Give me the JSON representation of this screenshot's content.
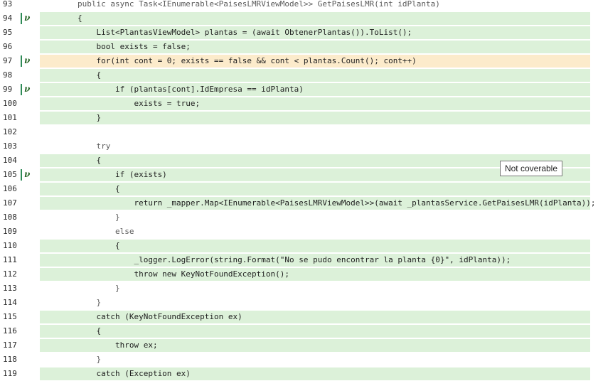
{
  "tooltip": "Not coverable",
  "lines": [
    {
      "n": "93",
      "code": "        public async Task<IEnumerable<PaisesLMRViewModel>> GetPaisesLMR(int idPlanta)",
      "cov": "none",
      "branch": false
    },
    {
      "n": "94",
      "code": "        {",
      "cov": "covered",
      "branch": true
    },
    {
      "n": "95",
      "code": "            List<PlantasViewModel> plantas = (await ObtenerPlantas()).ToList();",
      "cov": "covered",
      "branch": false
    },
    {
      "n": "96",
      "code": "            bool exists = false;",
      "cov": "covered",
      "branch": false
    },
    {
      "n": "97",
      "code": "            for(int cont = 0; exists == false && cont < plantas.Count(); cont++)",
      "cov": "partial",
      "branch": true
    },
    {
      "n": "98",
      "code": "            {",
      "cov": "covered",
      "branch": false
    },
    {
      "n": "99",
      "code": "                if (plantas[cont].IdEmpresa == idPlanta)",
      "cov": "covered",
      "branch": true
    },
    {
      "n": "100",
      "code": "                    exists = true;",
      "cov": "covered",
      "branch": false
    },
    {
      "n": "101",
      "code": "            }",
      "cov": "covered",
      "branch": false
    },
    {
      "n": "102",
      "code": "",
      "cov": "none",
      "branch": false
    },
    {
      "n": "103",
      "code": "            try",
      "cov": "none",
      "branch": false
    },
    {
      "n": "104",
      "code": "            {",
      "cov": "covered",
      "branch": false
    },
    {
      "n": "105",
      "code": "                if (exists)",
      "cov": "covered",
      "branch": true
    },
    {
      "n": "106",
      "code": "                {",
      "cov": "covered",
      "branch": false
    },
    {
      "n": "107",
      "code": "                    return _mapper.Map<IEnumerable<PaisesLMRViewModel>>(await _plantasService.GetPaisesLMR(idPlanta));",
      "cov": "covered",
      "branch": false
    },
    {
      "n": "108",
      "code": "                }",
      "cov": "none",
      "branch": false
    },
    {
      "n": "109",
      "code": "                else",
      "cov": "none",
      "branch": false
    },
    {
      "n": "110",
      "code": "                {",
      "cov": "covered",
      "branch": false
    },
    {
      "n": "111",
      "code": "                    _logger.LogError(string.Format(\"No se pudo encontrar la planta {0}\", idPlanta));",
      "cov": "covered",
      "branch": false
    },
    {
      "n": "112",
      "code": "                    throw new KeyNotFoundException();",
      "cov": "covered",
      "branch": false
    },
    {
      "n": "113",
      "code": "                }",
      "cov": "none",
      "branch": false
    },
    {
      "n": "114",
      "code": "            }",
      "cov": "none",
      "branch": false
    },
    {
      "n": "115",
      "code": "            catch (KeyNotFoundException ex)",
      "cov": "covered",
      "branch": false
    },
    {
      "n": "116",
      "code": "            {",
      "cov": "covered",
      "branch": false
    },
    {
      "n": "117",
      "code": "                throw ex;",
      "cov": "covered",
      "branch": false
    },
    {
      "n": "118",
      "code": "            }",
      "cov": "none",
      "branch": false
    },
    {
      "n": "119",
      "code": "            catch (Exception ex)",
      "cov": "covered",
      "branch": false
    }
  ]
}
